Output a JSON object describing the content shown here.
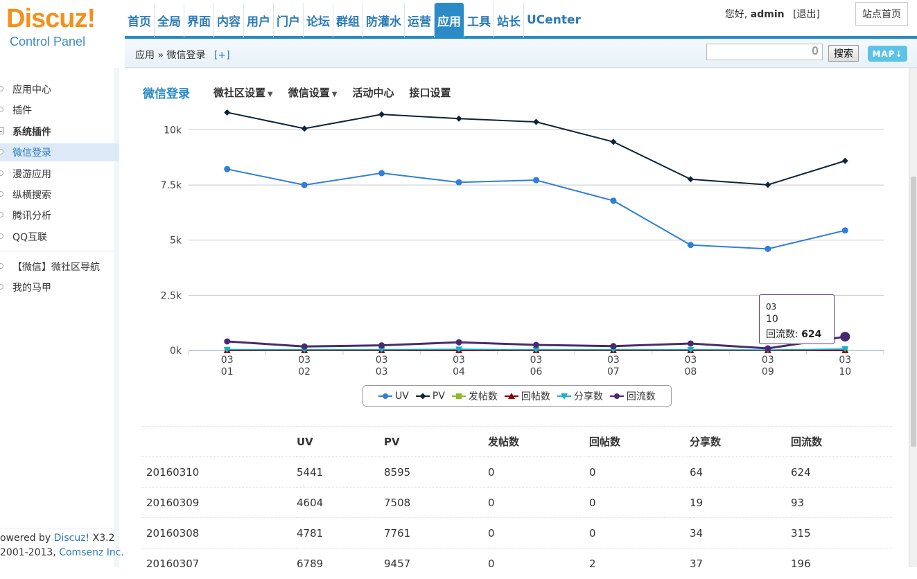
{
  "logo": {
    "brand": "Discuz!",
    "subtitle": "Control Panel"
  },
  "topnav": [
    {
      "label": "首页"
    },
    {
      "label": "全局"
    },
    {
      "label": "界面"
    },
    {
      "label": "内容"
    },
    {
      "label": "用户"
    },
    {
      "label": "门户"
    },
    {
      "label": "论坛"
    },
    {
      "label": "群组"
    },
    {
      "label": "防灌水"
    },
    {
      "label": "运营"
    },
    {
      "label": "应用",
      "active": true
    },
    {
      "label": "工具"
    },
    {
      "label": "站长"
    },
    {
      "label": "UCenter"
    }
  ],
  "user": {
    "greeting": "您好,",
    "name": "admin",
    "logout": "[退出]",
    "site_home": "站点首页"
  },
  "breadcrumb": {
    "path": "应用 » 微信登录",
    "add": "[+]"
  },
  "search": {
    "value": "",
    "button": "搜索",
    "map": "MAP"
  },
  "sidebar": {
    "items": [
      {
        "label": "应用中心"
      },
      {
        "label": "插件"
      },
      {
        "label": "系统插件",
        "group": true
      },
      {
        "label": "微信登录",
        "active": true
      },
      {
        "label": "漫游应用"
      },
      {
        "label": "纵横搜索"
      },
      {
        "label": "腾讯分析"
      },
      {
        "label": "QQ互联"
      },
      {
        "label": "【微信】微社区导航"
      },
      {
        "label": "我的马甲"
      }
    ],
    "footer_line1_prefix": "owered by ",
    "footer_line1_link": "Discuz!",
    "footer_line1_suffix": " X3.2",
    "footer_line2_prefix": " 2001-2013, ",
    "footer_line2_link": "Comsenz Inc."
  },
  "tabs": {
    "title": "微信登录",
    "items": [
      {
        "label": "微社区设置",
        "dropdown": true
      },
      {
        "label": "微信设置",
        "dropdown": true
      },
      {
        "label": "活动中心"
      },
      {
        "label": "接口设置"
      }
    ]
  },
  "tooltip": {
    "line1": "03",
    "line2": "10",
    "label": "回流数:",
    "value": "624"
  },
  "colors": {
    "uv": "#2f7ed8",
    "pv": "#0d233a",
    "posts": "#8bbc21",
    "replies": "#910000",
    "shares": "#1aadce",
    "returns": "#492970"
  },
  "chart_data": {
    "type": "line",
    "x": [
      "03 01",
      "03 02",
      "03 03",
      "03 04",
      "03 06",
      "03 07",
      "03 08",
      "03 09",
      "03 10"
    ],
    "ylim": [
      0,
      10800
    ],
    "yticks": [
      "0k",
      "2.5k",
      "5k",
      "7.5k",
      "10k"
    ],
    "ytick_values": [
      0,
      2500,
      5000,
      7500,
      10000
    ],
    "series": [
      {
        "name": "UV",
        "values": [
          8220,
          7500,
          8040,
          7620,
          7720,
          6789,
          4781,
          4604,
          5441
        ]
      },
      {
        "name": "PV",
        "values": [
          10790,
          10060,
          10700,
          10510,
          10360,
          9457,
          7761,
          7508,
          8595
        ]
      },
      {
        "name": "发帖数",
        "values": [
          0,
          0,
          0,
          0,
          0,
          0,
          0,
          0,
          0
        ]
      },
      {
        "name": "回帖数",
        "values": [
          0,
          0,
          0,
          0,
          0,
          2,
          0,
          0,
          0
        ]
      },
      {
        "name": "分享数",
        "values": [
          40,
          30,
          35,
          50,
          30,
          37,
          34,
          19,
          64
        ]
      },
      {
        "name": "回流数",
        "values": [
          410,
          180,
          230,
          370,
          250,
          196,
          315,
          93,
          624
        ]
      }
    ]
  },
  "table": {
    "headers": [
      "",
      "UV",
      "PV",
      "发帖数",
      "回帖数",
      "分享数",
      "回流数"
    ],
    "rows": [
      [
        "20160310",
        "5441",
        "8595",
        "0",
        "0",
        "64",
        "624"
      ],
      [
        "20160309",
        "4604",
        "7508",
        "0",
        "0",
        "19",
        "93"
      ],
      [
        "20160308",
        "4781",
        "7761",
        "0",
        "0",
        "34",
        "315"
      ],
      [
        "20160307",
        "6789",
        "9457",
        "0",
        "2",
        "37",
        "196"
      ]
    ]
  }
}
